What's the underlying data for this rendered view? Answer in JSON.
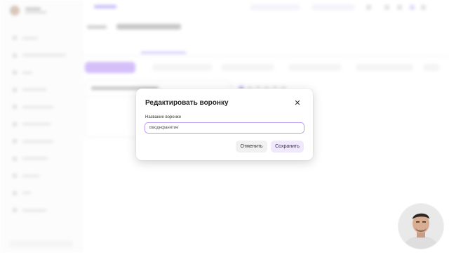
{
  "modal": {
    "title": "Редактировать воронку",
    "field_label": "Название воронки",
    "field_value": "Вводнфанятие",
    "cancel_label": "Отменить",
    "save_label": "Сохранить",
    "close_icon": "close-icon"
  },
  "colors": {
    "accent": "#8b6cf0",
    "input_border": "#b79cf0",
    "save_bg": "#f0e9fb",
    "cancel_bg": "#f1f1f1"
  },
  "icons": {
    "avatar": "avatar",
    "webcam": "presenter-webcam"
  }
}
